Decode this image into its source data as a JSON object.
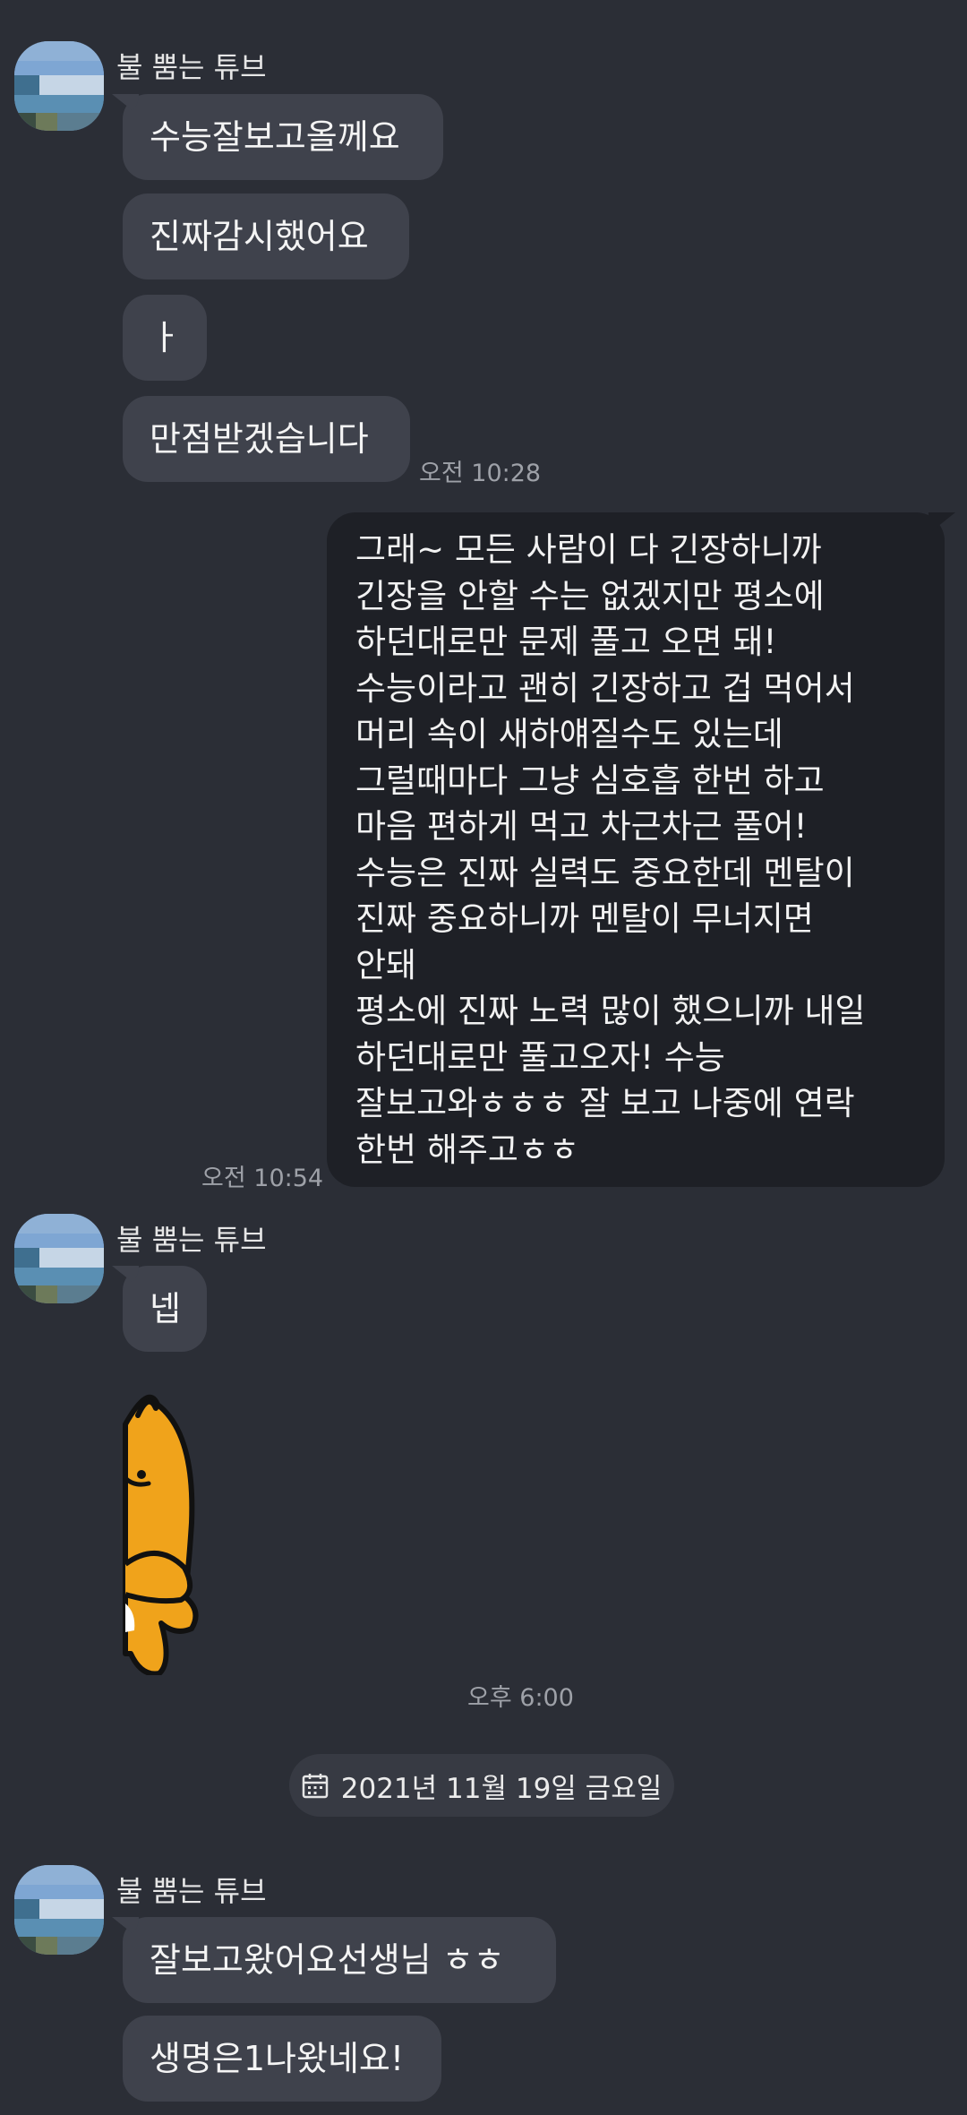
{
  "colors": {
    "background": "#2b2e36",
    "incoming_bubble": "#3f424c",
    "outgoing_bubble": "#1e2026",
    "timestamp": "#9ea1a8",
    "sticker_orange": "#f0a31b"
  },
  "contact": {
    "name": "불 뿜는 튜브"
  },
  "group1": {
    "messages": [
      "수능잘보고올께요",
      "진짜감시했어요",
      "ㅏ",
      "만점받겠습니다"
    ],
    "time": "오전 10:28"
  },
  "reply": {
    "lines": [
      "그래~ 모든 사람이 다 긴장하니까",
      "긴장을 안할 수는 없겠지만 평소에",
      "하던대로만 문제 풀고 오면 돼!",
      "수능이라고 괜히 긴장하고 겁 먹어서",
      "머리 속이 새하얘질수도 있는데",
      "그럴때마다 그냥 심호흡 한번 하고",
      "마음 편하게 먹고 차근차근 풀어!",
      "수능은 진짜 실력도 중요한데 멘탈이",
      "진짜 중요하니까 멘탈이 무너지면",
      "안돼",
      "평소에 진짜 노력 많이 했으니까 내일",
      "하던대로만 풀고오자! 수능",
      "잘보고와ㅎㅎㅎ 잘 보고 나중에 연락",
      "한번 해주고ㅎㅎ"
    ],
    "time": "오전 10:54"
  },
  "group2": {
    "messages": [
      "넵"
    ],
    "sticker_icon": "ryan-peeking-sticker-icon",
    "time": "오후 6:00"
  },
  "date_divider": {
    "icon": "calendar-icon",
    "text": "2021년 11월 19일 금요일"
  },
  "group3": {
    "messages": [
      "잘보고왔어요선생님 ㅎㅎ",
      "생명은1나왔네요!"
    ]
  }
}
